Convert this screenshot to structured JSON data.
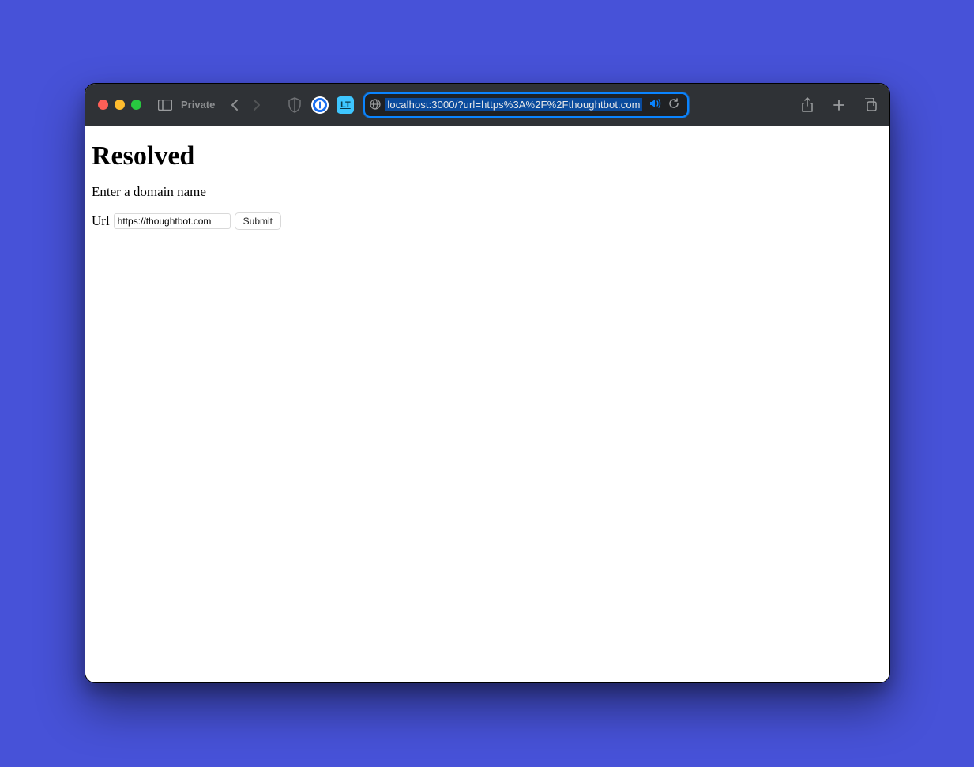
{
  "browser": {
    "private_label": "Private",
    "address_url": "localhost:3000/?url=https%3A%2F%2Fthoughtbot.com"
  },
  "page": {
    "title": "Resolved",
    "subtitle": "Enter a domain name",
    "form": {
      "label": "Url",
      "url_value": "https://thoughtbot.com",
      "submit_label": "Submit"
    }
  }
}
